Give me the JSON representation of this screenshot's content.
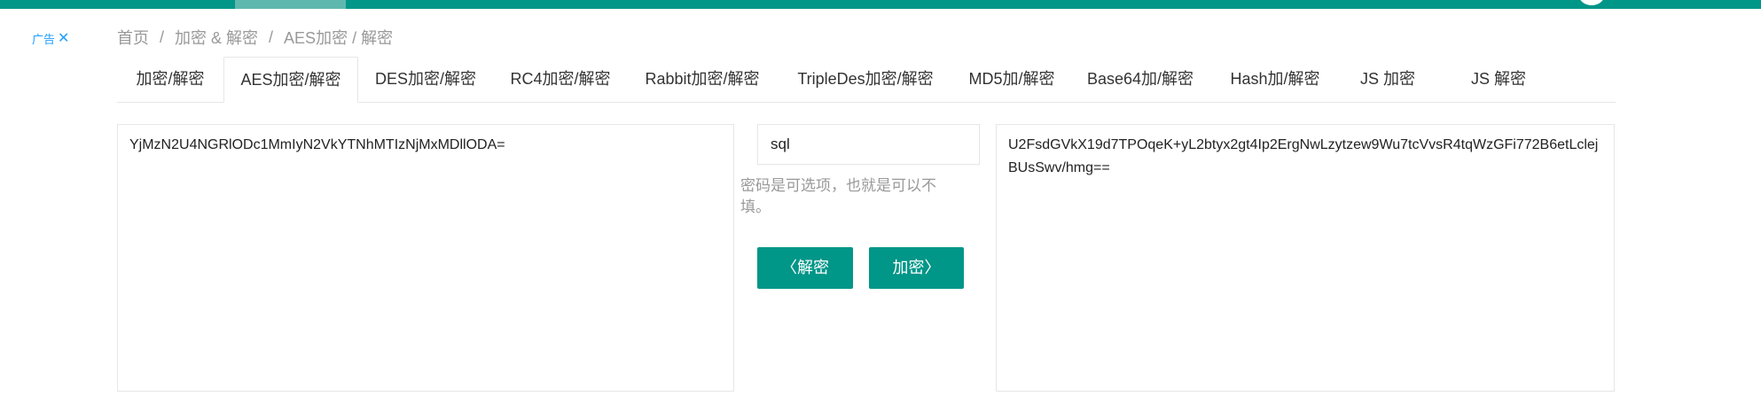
{
  "ad": {
    "label": "广告",
    "close_glyph": "✕"
  },
  "breadcrumb": {
    "items": [
      "首页",
      "加密 & 解密",
      "AES加密 / 解密"
    ],
    "separator": "/"
  },
  "tabs": [
    {
      "label": "加密/解密",
      "active": false
    },
    {
      "label": "AES加密/解密",
      "active": true
    },
    {
      "label": "DES加密/解密",
      "active": false
    },
    {
      "label": "RC4加密/解密",
      "active": false
    },
    {
      "label": "Rabbit加密/解密",
      "active": false
    },
    {
      "label": "TripleDes加密/解密",
      "active": false
    },
    {
      "label": "MD5加/解密",
      "active": false
    },
    {
      "label": "Base64加/解密",
      "active": false
    },
    {
      "label": "Hash加/解密",
      "active": false
    },
    {
      "label": "JS 加密",
      "active": false
    },
    {
      "label": "JS 解密",
      "active": false
    }
  ],
  "left_text": "YjMzN2U4NGRlODc1MmIyN2VkYTNhMTIzNjMxMDllODA=",
  "key_value": "sql",
  "key_hint": "密码是可选项，也就是可以不填。",
  "buttons": {
    "decrypt_label": "解密",
    "decrypt_glyph": "〈",
    "encrypt_label": "加密",
    "encrypt_glyph": "〉"
  },
  "right_text": "U2FsdGVkX19d7TPOqeK+yL2btyx2gt4Ip2ErgNwLzytzew9Wu7tcVvsR4tqWzGFi772B6etLclejBUsSwv/hmg==",
  "colors": {
    "primary": "#009688",
    "ad": "#1e9fff",
    "muted": "#999999",
    "border": "#e6e6e6"
  }
}
